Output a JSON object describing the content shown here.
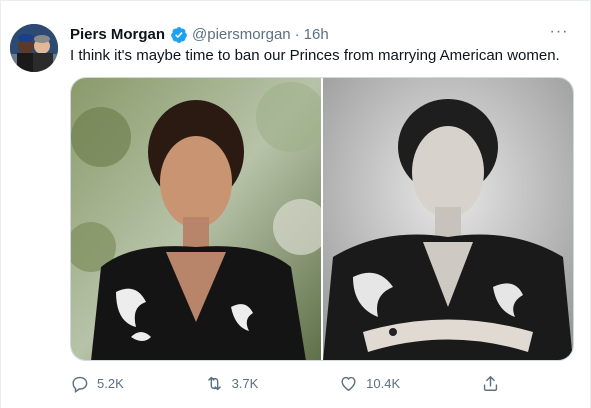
{
  "tweet": {
    "author_name": "Piers Morgan",
    "handle": "@piersmorgan",
    "separator": "·",
    "timestamp": "16h",
    "text": "I think it's maybe time to ban our Princes from marrying American women.",
    "more_label": "···"
  },
  "actions": {
    "reply_count": "5.2K",
    "retweet_count": "3.7K",
    "like_count": "10.4K"
  },
  "colors": {
    "verified_badge": "#1da1f2",
    "secondary_text": "#5b7083",
    "primary_text": "#0f1419"
  }
}
